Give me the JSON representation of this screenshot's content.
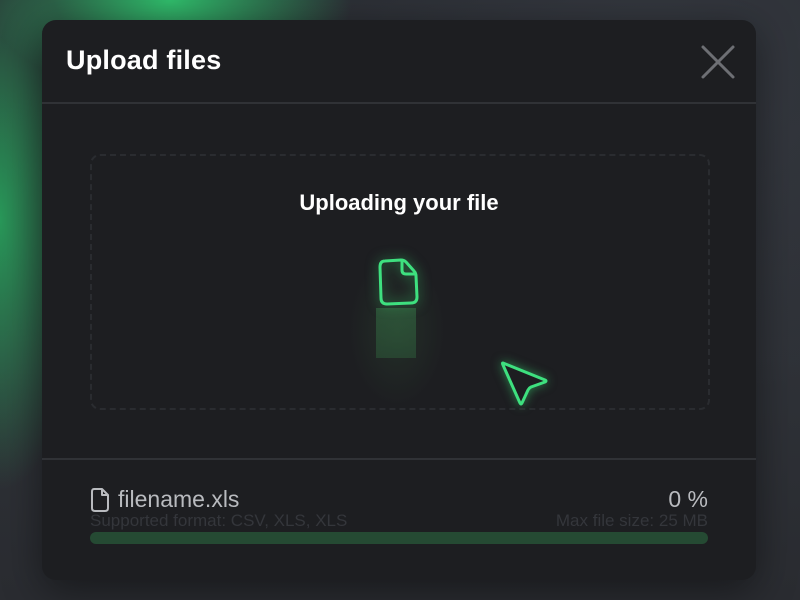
{
  "modal": {
    "title": "Upload files",
    "close_icon": "close-icon"
  },
  "upload_area": {
    "status_text": "Uploading your file",
    "file_icon": "file-icon",
    "cursor_icon": "cursor-arrow-icon"
  },
  "file": {
    "name": "filename.xls",
    "percent_text": "0 %",
    "progress": 0,
    "icon": "file-icon"
  },
  "info": {
    "supported_format": "Supported format: CSV, XLS, XLS",
    "max_file_size": "Max file size: 25 MB"
  },
  "colors": {
    "accent": "#3fd37d",
    "modal_background": "#1d1e21",
    "progress_track": "#254a33"
  }
}
